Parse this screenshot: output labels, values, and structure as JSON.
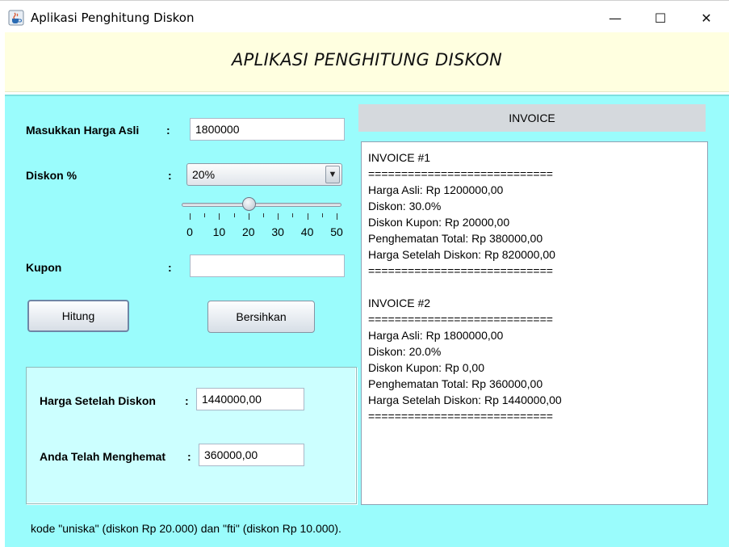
{
  "window": {
    "title": "Aplikasi Penghitung Diskon",
    "minimize_glyph": "—",
    "maximize_glyph": "☐",
    "close_glyph": "✕"
  },
  "banner": {
    "title": "APLIKASI PENGHITUNG DISKON"
  },
  "form": {
    "harga_label": "Masukkan Harga Asli",
    "harga_value": "1800000",
    "diskon_label": "Diskon %",
    "diskon_selected": "20%",
    "kupon_label": "Kupon",
    "kupon_value": "",
    "colon": ":"
  },
  "slider": {
    "value": 20,
    "min": 0,
    "max": 50,
    "tick_labels": [
      "0",
      "10",
      "20",
      "30",
      "40",
      "50"
    ]
  },
  "buttons": {
    "hitung": "Hitung",
    "bersihkan": "Bersihkan"
  },
  "results": {
    "harga_setelah_label": "Harga Setelah Diskon",
    "harga_setelah_value": "1440000,00",
    "hemat_label": "Anda Telah Menghemat",
    "hemat_value": "360000,00"
  },
  "invoice": {
    "header": "INVOICE",
    "text": "INVOICE #1\n============================\nHarga Asli: Rp 1200000,00\nDiskon: 30.0%\nDiskon Kupon: Rp 20000,00\nPenghematan Total: Rp 380000,00\nHarga Setelah Diskon: Rp 820000,00\n============================\n\nINVOICE #2\n============================\nHarga Asli: Rp 1800000,00\nDiskon: 20.0%\nDiskon Kupon: Rp 0,00\nPenghematan Total: Rp 360000,00\nHarga Setelah Diskon: Rp 1440000,00\n============================"
  },
  "footer": {
    "note": "kode \"uniska\" (diskon Rp 20.000) dan \"fti\" (diskon Rp 10.000)."
  },
  "icons": {
    "app": "java-cup-icon",
    "combo_arrow": "chevron-down-icon"
  },
  "colors": {
    "main_bg": "#9afcfc",
    "banner_bg": "#ffffe0",
    "result_bg": "#ccffff"
  }
}
